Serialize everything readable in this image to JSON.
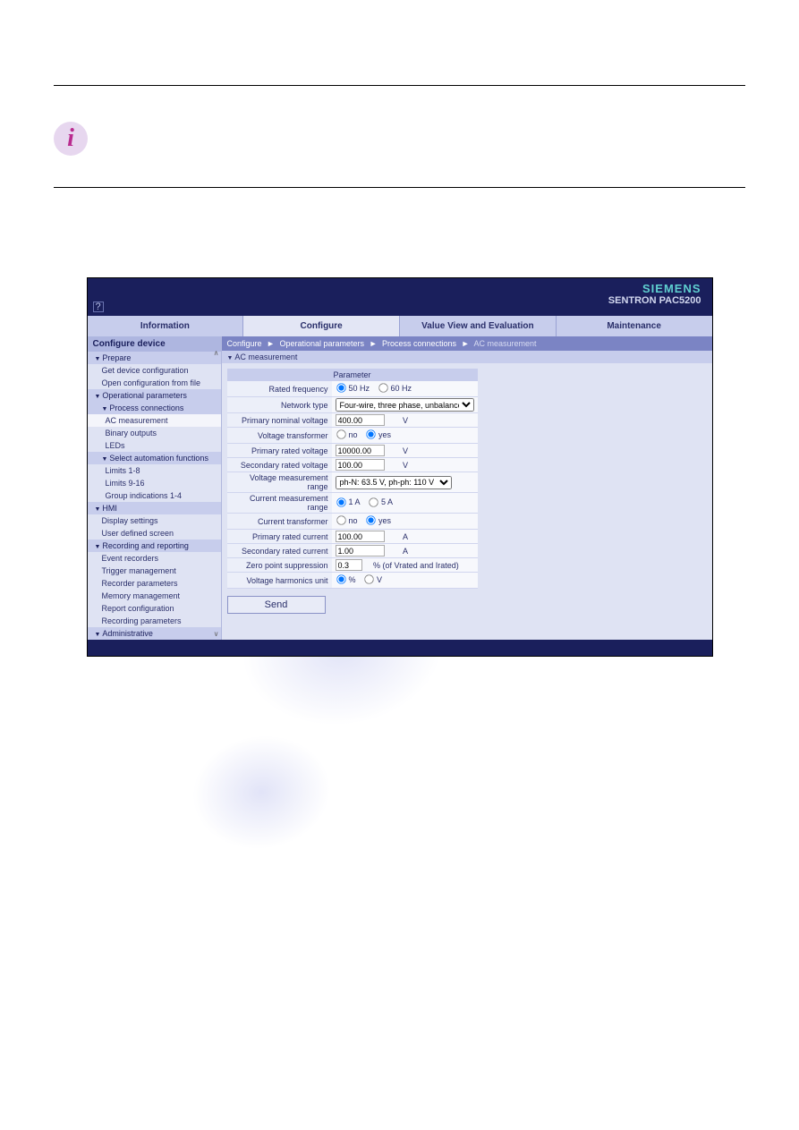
{
  "brand": {
    "company": "SIEMENS",
    "model": "SENTRON PAC5200"
  },
  "tabs": {
    "info": "Information",
    "configure": "Configure",
    "valueview": "Value View and Evaluation",
    "maintenance": "Maintenance"
  },
  "sidebar": {
    "title": "Configure device",
    "prepare": "Prepare",
    "prepare_items": [
      "Get device configuration",
      "Open configuration from file"
    ],
    "op_params": "Operational parameters",
    "process_conn": "Process connections",
    "process_conn_items": [
      "AC measurement",
      "Binary outputs",
      "LEDs"
    ],
    "select_auto": "Select automation functions",
    "select_auto_items": [
      "Limits 1-8",
      "Limits 9-16",
      "Group indications 1-4"
    ],
    "hmi": "HMI",
    "hmi_items": [
      "Display settings",
      "User defined screen"
    ],
    "rec_rep": "Recording and reporting",
    "rec_rep_items": [
      "Event recorders",
      "Trigger management",
      "Recorder parameters",
      "Memory management",
      "Report configuration",
      "Recording parameters"
    ],
    "admin": "Administrative"
  },
  "breadcrumb": {
    "a": "Configure",
    "b": "Operational parameters",
    "c": "Process connections",
    "d": "AC measurement"
  },
  "section": "AC measurement",
  "params": {
    "header": "Parameter",
    "rated_freq": {
      "label": "Rated frequency",
      "opt1": "50 Hz",
      "opt2": "60 Hz"
    },
    "network_type": {
      "label": "Network type",
      "selected": "Four-wire, three phase, unbalanced"
    },
    "prim_nom_v": {
      "label": "Primary nominal voltage",
      "value": "400.00",
      "unit": "V"
    },
    "volt_trans": {
      "label": "Voltage transformer",
      "opt1": "no",
      "opt2": "yes"
    },
    "prim_rated_v": {
      "label": "Primary rated voltage",
      "value": "10000.00",
      "unit": "V"
    },
    "sec_rated_v": {
      "label": "Secondary rated voltage",
      "value": "100.00",
      "unit": "V"
    },
    "v_meas_range": {
      "label": "Voltage measurement range",
      "selected": "ph-N: 63.5 V, ph-ph: 110 V"
    },
    "c_meas_range": {
      "label": "Current measurement range",
      "opt1": "1 A",
      "opt2": "5 A"
    },
    "curr_trans": {
      "label": "Current transformer",
      "opt1": "no",
      "opt2": "yes"
    },
    "prim_rated_c": {
      "label": "Primary rated current",
      "value": "100.00",
      "unit": "A"
    },
    "sec_rated_c": {
      "label": "Secondary rated current",
      "value": "1.00",
      "unit": "A"
    },
    "zero_point": {
      "label": "Zero point suppression",
      "value": "0.3",
      "unit": "% (of Vrated and Irated)"
    },
    "v_harm_unit": {
      "label": "Voltage harmonics unit",
      "opt1": "%",
      "opt2": "V"
    }
  },
  "buttons": {
    "send": "Send"
  }
}
